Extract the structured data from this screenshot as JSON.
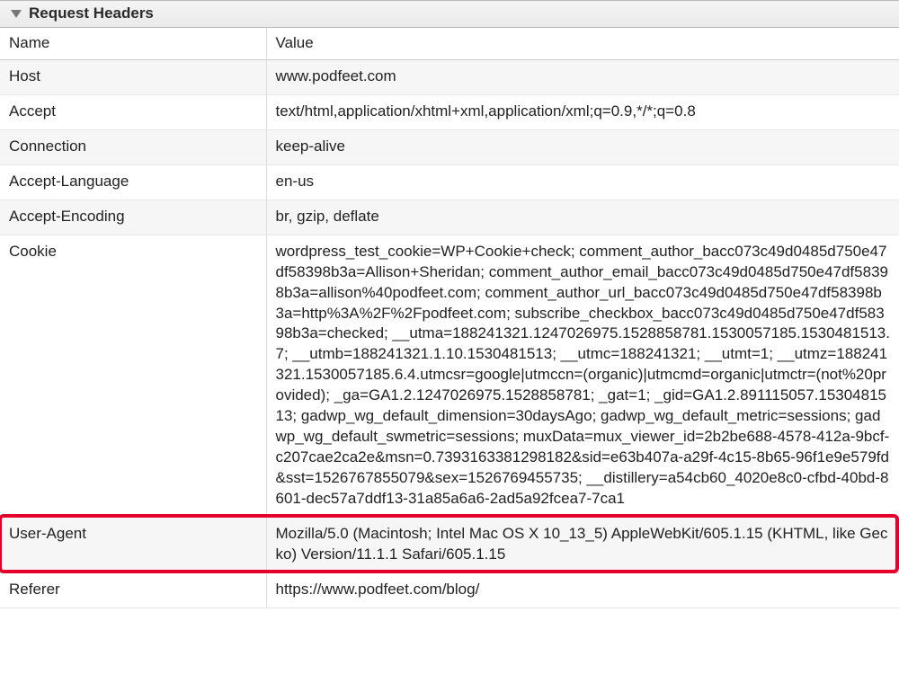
{
  "section": {
    "title": "Request Headers"
  },
  "columns": {
    "name": "Name",
    "value": "Value"
  },
  "rows": [
    {
      "name": "Host",
      "value": "www.podfeet.com"
    },
    {
      "name": "Accept",
      "value": "text/html,application/xhtml+xml,application/xml;q=0.9,*/*;q=0.8"
    },
    {
      "name": "Connection",
      "value": "keep-alive"
    },
    {
      "name": "Accept-Language",
      "value": "en-us"
    },
    {
      "name": "Accept-Encoding",
      "value": "br, gzip, deflate"
    },
    {
      "name": "Cookie",
      "value": "wordpress_test_cookie=WP+Cookie+check; comment_author_bacc073c49d0485d750e47df58398b3a=Allison+Sheridan; comment_author_email_bacc073c49d0485d750e47df58398b3a=allison%40podfeet.com; comment_author_url_bacc073c49d0485d750e47df58398b3a=http%3A%2F%2Fpodfeet.com; subscribe_checkbox_bacc073c49d0485d750e47df58398b3a=checked; __utma=188241321.1247026975.1528858781.1530057185.1530481513.7; __utmb=188241321.1.10.1530481513; __utmc=188241321; __utmt=1; __utmz=188241321.1530057185.6.4.utmcsr=google|utmccn=(organic)|utmcmd=organic|utmctr=(not%20provided); _ga=GA1.2.1247026975.1528858781; _gat=1; _gid=GA1.2.891115057.1530481513; gadwp_wg_default_dimension=30daysAgo; gadwp_wg_default_metric=sessions; gadwp_wg_default_swmetric=sessions; muxData=mux_viewer_id=2b2be688-4578-412a-9bcf-c207cae2ca2e&msn=0.7393163381298182&sid=e63b407a-a29f-4c15-8b65-96f1e9e579fd&sst=1526767855079&sex=1526769455735; __distillery=a54cb60_4020e8c0-cfbd-40bd-8601-dec57a7ddf13-31a85a6a6-2ad5a92fcea7-7ca1"
    },
    {
      "name": "User-Agent",
      "value": "Mozilla/5.0 (Macintosh; Intel Mac OS X 10_13_5) AppleWebKit/605.1.15 (KHTML, like Gecko) Version/11.1.1 Safari/605.1.15"
    },
    {
      "name": "Referer",
      "value": "https://www.podfeet.com/blog/"
    }
  ],
  "highlight_row_index": 6
}
